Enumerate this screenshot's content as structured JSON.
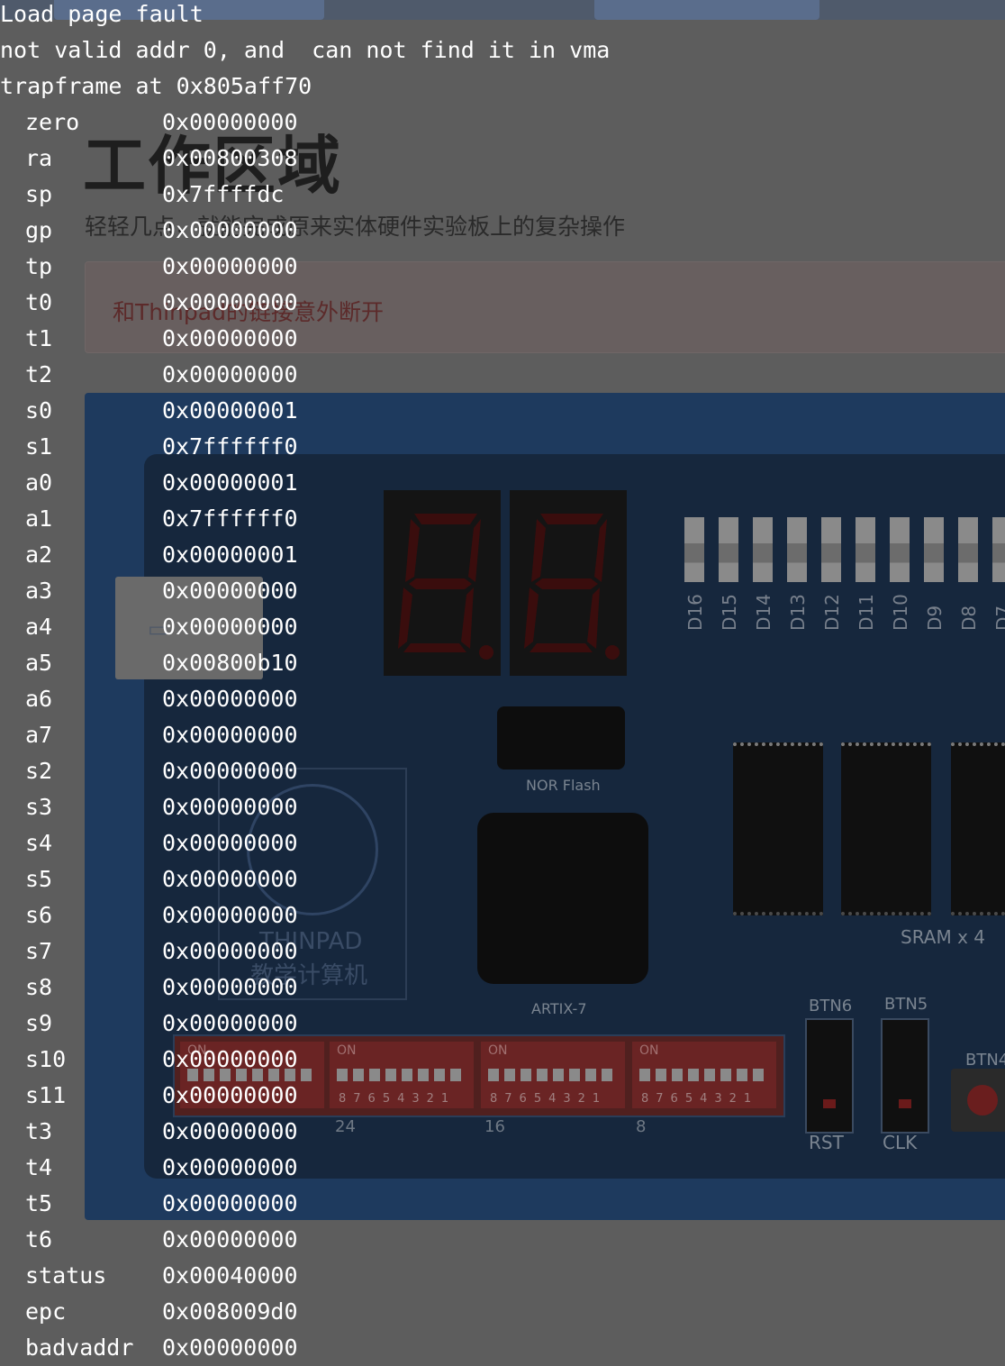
{
  "background": {
    "heading": "工作区域",
    "subtitle": "轻轻几点，就能完成原来实体硬件实验板上的复杂操作",
    "alert": "和Thinpad的链接意外断开",
    "board": {
      "seven_segment_count": 2,
      "leds": [
        "D16",
        "D15",
        "D14",
        "D13",
        "D12",
        "D11",
        "D10",
        "D9",
        "D8",
        "D7"
      ],
      "nor_flash_label": "NOR Flash",
      "fpga_label": "ARTIX-7",
      "sram_label": "SRAM x 4",
      "logo_line1": "THINPAD",
      "logo_line2": "教学计算机",
      "dip_on": "ON",
      "dip_digits": "87654321",
      "dip_numbers": [
        "24",
        "16",
        "8"
      ],
      "buttons": {
        "btn6": "BTN6",
        "btn5": "BTN5",
        "btn4": "BTN4",
        "rst": "RST",
        "clk": "CLK"
      }
    }
  },
  "terminal": {
    "lines": [
      "Load page fault",
      "not valid addr 0, and  can not find it in vma",
      "trapframe at 0x805aff70"
    ],
    "registers": [
      {
        "name": "zero",
        "value": "0x00000000"
      },
      {
        "name": "ra",
        "value": "0x00800308"
      },
      {
        "name": "sp",
        "value": "0x7ffffdc"
      },
      {
        "name": "gp",
        "value": "0x00000000"
      },
      {
        "name": "tp",
        "value": "0x00000000"
      },
      {
        "name": "t0",
        "value": "0x00000000"
      },
      {
        "name": "t1",
        "value": "0x00000000"
      },
      {
        "name": "t2",
        "value": "0x00000000"
      },
      {
        "name": "s0",
        "value": "0x00000001"
      },
      {
        "name": "s1",
        "value": "0x7ffffff0"
      },
      {
        "name": "a0",
        "value": "0x00000001"
      },
      {
        "name": "a1",
        "value": "0x7ffffff0"
      },
      {
        "name": "a2",
        "value": "0x00000001"
      },
      {
        "name": "a3",
        "value": "0x00000000"
      },
      {
        "name": "a4",
        "value": "0x00000000"
      },
      {
        "name": "a5",
        "value": "0x00800b10"
      },
      {
        "name": "a6",
        "value": "0x00000000"
      },
      {
        "name": "a7",
        "value": "0x00000000"
      },
      {
        "name": "s2",
        "value": "0x00000000"
      },
      {
        "name": "s3",
        "value": "0x00000000"
      },
      {
        "name": "s4",
        "value": "0x00000000"
      },
      {
        "name": "s5",
        "value": "0x00000000"
      },
      {
        "name": "s6",
        "value": "0x00000000"
      },
      {
        "name": "s7",
        "value": "0x00000000"
      },
      {
        "name": "s8",
        "value": "0x00000000"
      },
      {
        "name": "s9",
        "value": "0x00000000"
      },
      {
        "name": "s10",
        "value": "0x00000000"
      },
      {
        "name": "s11",
        "value": "0x00000000"
      },
      {
        "name": "t3",
        "value": "0x00000000"
      },
      {
        "name": "t4",
        "value": "0x00000000"
      },
      {
        "name": "t5",
        "value": "0x00000000"
      },
      {
        "name": "t6",
        "value": "0x00000000"
      },
      {
        "name": "status",
        "value": "0x00040000"
      },
      {
        "name": "epc",
        "value": "0x008009d0"
      },
      {
        "name": "badvaddr",
        "value": "0x00000000"
      }
    ]
  }
}
